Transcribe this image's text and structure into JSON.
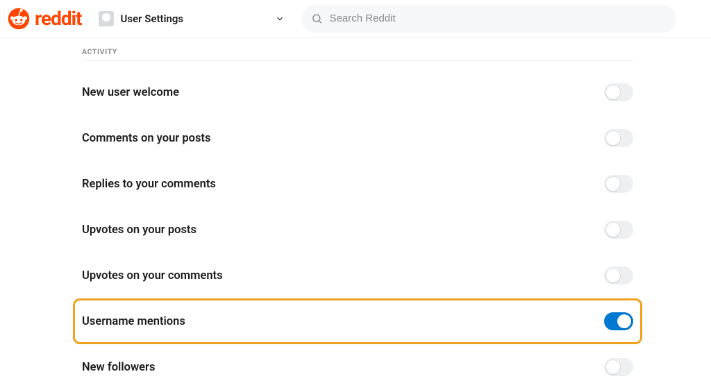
{
  "header": {
    "brand": "reddit",
    "page_selector_label": "User Settings",
    "search_placeholder": "Search Reddit"
  },
  "section": {
    "title": "ACTIVITY"
  },
  "settings": [
    {
      "id": "new-user-welcome",
      "label": "New user welcome",
      "on": false,
      "highlighted": false
    },
    {
      "id": "comments-on-posts",
      "label": "Comments on your posts",
      "on": false,
      "highlighted": false
    },
    {
      "id": "replies-to-comments",
      "label": "Replies to your comments",
      "on": false,
      "highlighted": false
    },
    {
      "id": "upvotes-on-posts",
      "label": "Upvotes on your posts",
      "on": false,
      "highlighted": false
    },
    {
      "id": "upvotes-on-comments",
      "label": "Upvotes on your comments",
      "on": false,
      "highlighted": false
    },
    {
      "id": "username-mentions",
      "label": "Username mentions",
      "on": true,
      "highlighted": true
    },
    {
      "id": "new-followers",
      "label": "New followers",
      "on": false,
      "highlighted": false
    }
  ],
  "colors": {
    "brand": "#ff4500",
    "toggle_on": "#0079d3",
    "highlight": "#f0a020"
  }
}
